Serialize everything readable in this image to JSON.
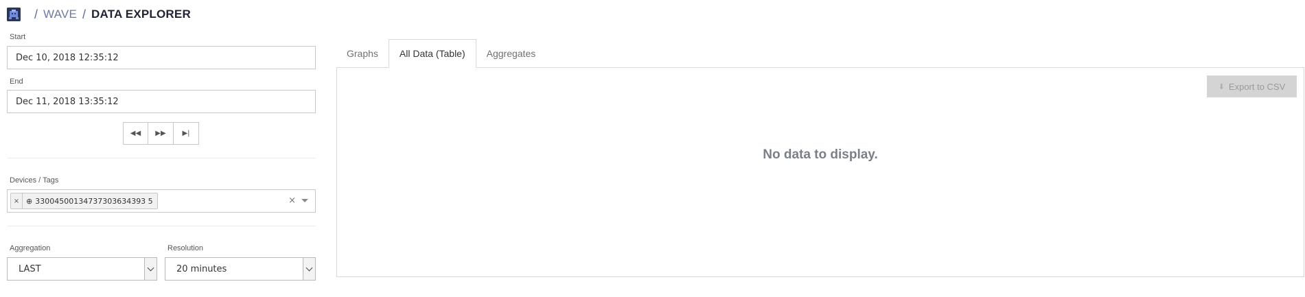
{
  "breadcrumb": {
    "separator": "/",
    "app": "WAVE",
    "current": "DATA EXPLORER"
  },
  "filters": {
    "start_label": "Start",
    "start_value": "Dec 10, 2018 12:35:12",
    "end_label": "End",
    "end_value": "Dec 11, 2018 13:35:12",
    "nav_buttons": {
      "rewind": "◀◀",
      "forward": "▶▶",
      "last": "▶|"
    },
    "devices_label": "Devices / Tags",
    "tag": {
      "remove": "×",
      "icon": "⊕",
      "value": "33004500134737303634393 5"
    },
    "clear_all": "×",
    "aggregation_label": "Aggregation",
    "aggregation_value": "LAST",
    "resolution_label": "Resolution",
    "resolution_value": "20 minutes"
  },
  "tabs": [
    {
      "label": "Graphs"
    },
    {
      "label": "All Data (Table)"
    },
    {
      "label": "Aggregates"
    }
  ],
  "panel": {
    "export_label": "Export to CSV",
    "export_icon": "⬇",
    "empty_message": "No data to display."
  },
  "colors": {
    "brand_dark": "#2c3557",
    "breadcrumb_link": "#6d7aa3",
    "disabled_button": "#d4d4d4"
  }
}
